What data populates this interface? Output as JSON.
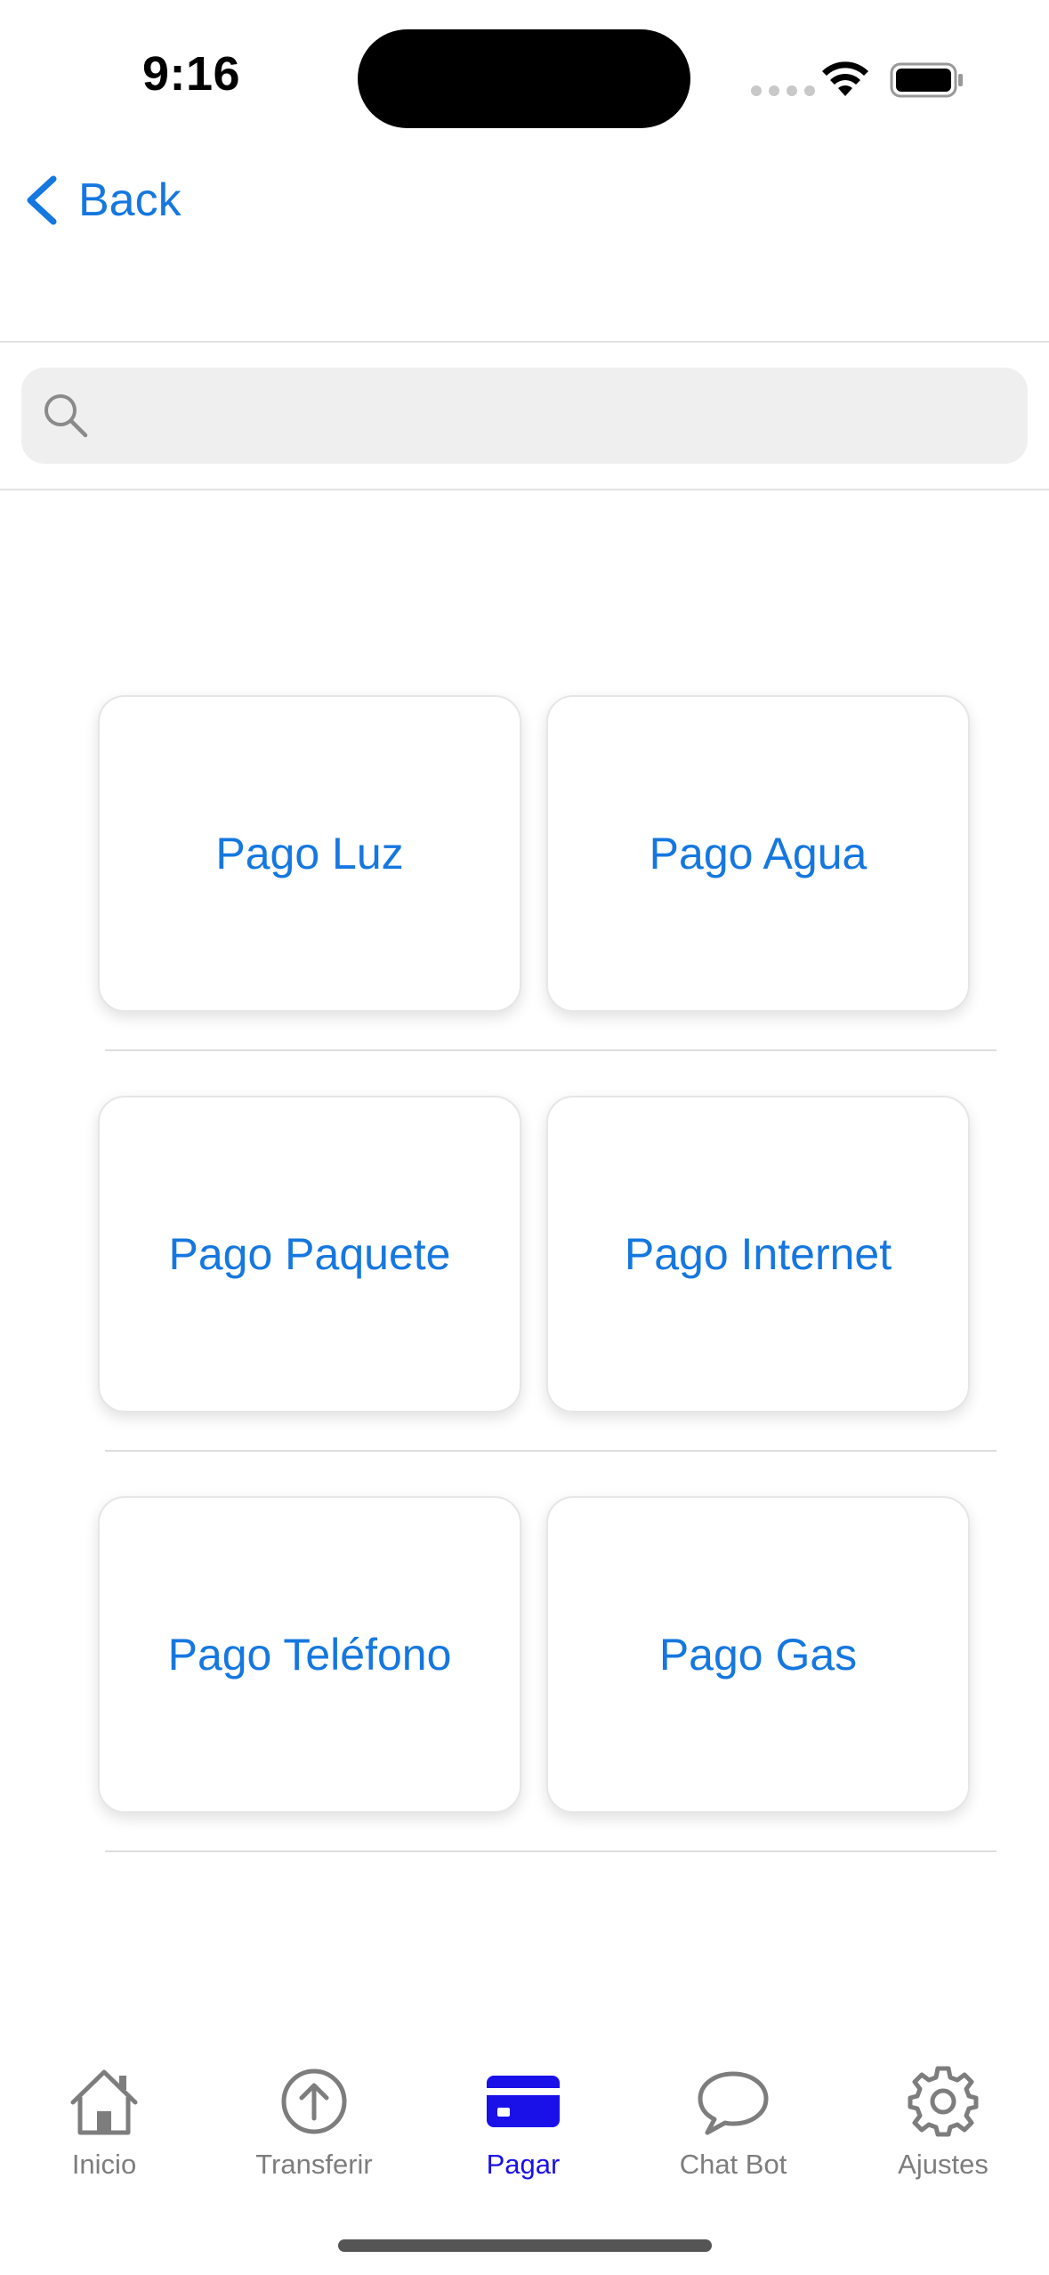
{
  "status_bar": {
    "time": "9:16"
  },
  "nav": {
    "back_label": "Back"
  },
  "search": {
    "placeholder": "",
    "value": ""
  },
  "payment_options": [
    {
      "label": "Pago Luz"
    },
    {
      "label": "Pago Agua"
    },
    {
      "label": "Pago Paquete"
    },
    {
      "label": "Pago Internet"
    },
    {
      "label": "Pago Teléfono"
    },
    {
      "label": "Pago Gas"
    }
  ],
  "tab_bar": {
    "items": [
      {
        "label": "Inicio",
        "icon": "house-icon"
      },
      {
        "label": "Transferir",
        "icon": "arrow-up-circle-icon"
      },
      {
        "label": "Pagar",
        "icon": "credit-card-icon",
        "active": true
      },
      {
        "label": "Chat Bot",
        "icon": "chat-bubble-icon"
      },
      {
        "label": "Ajustes",
        "icon": "gear-icon"
      }
    ]
  },
  "colors": {
    "accent": "#1577e0",
    "active_tab": "#1a10e8",
    "inactive_tab": "#7d7d7d"
  }
}
